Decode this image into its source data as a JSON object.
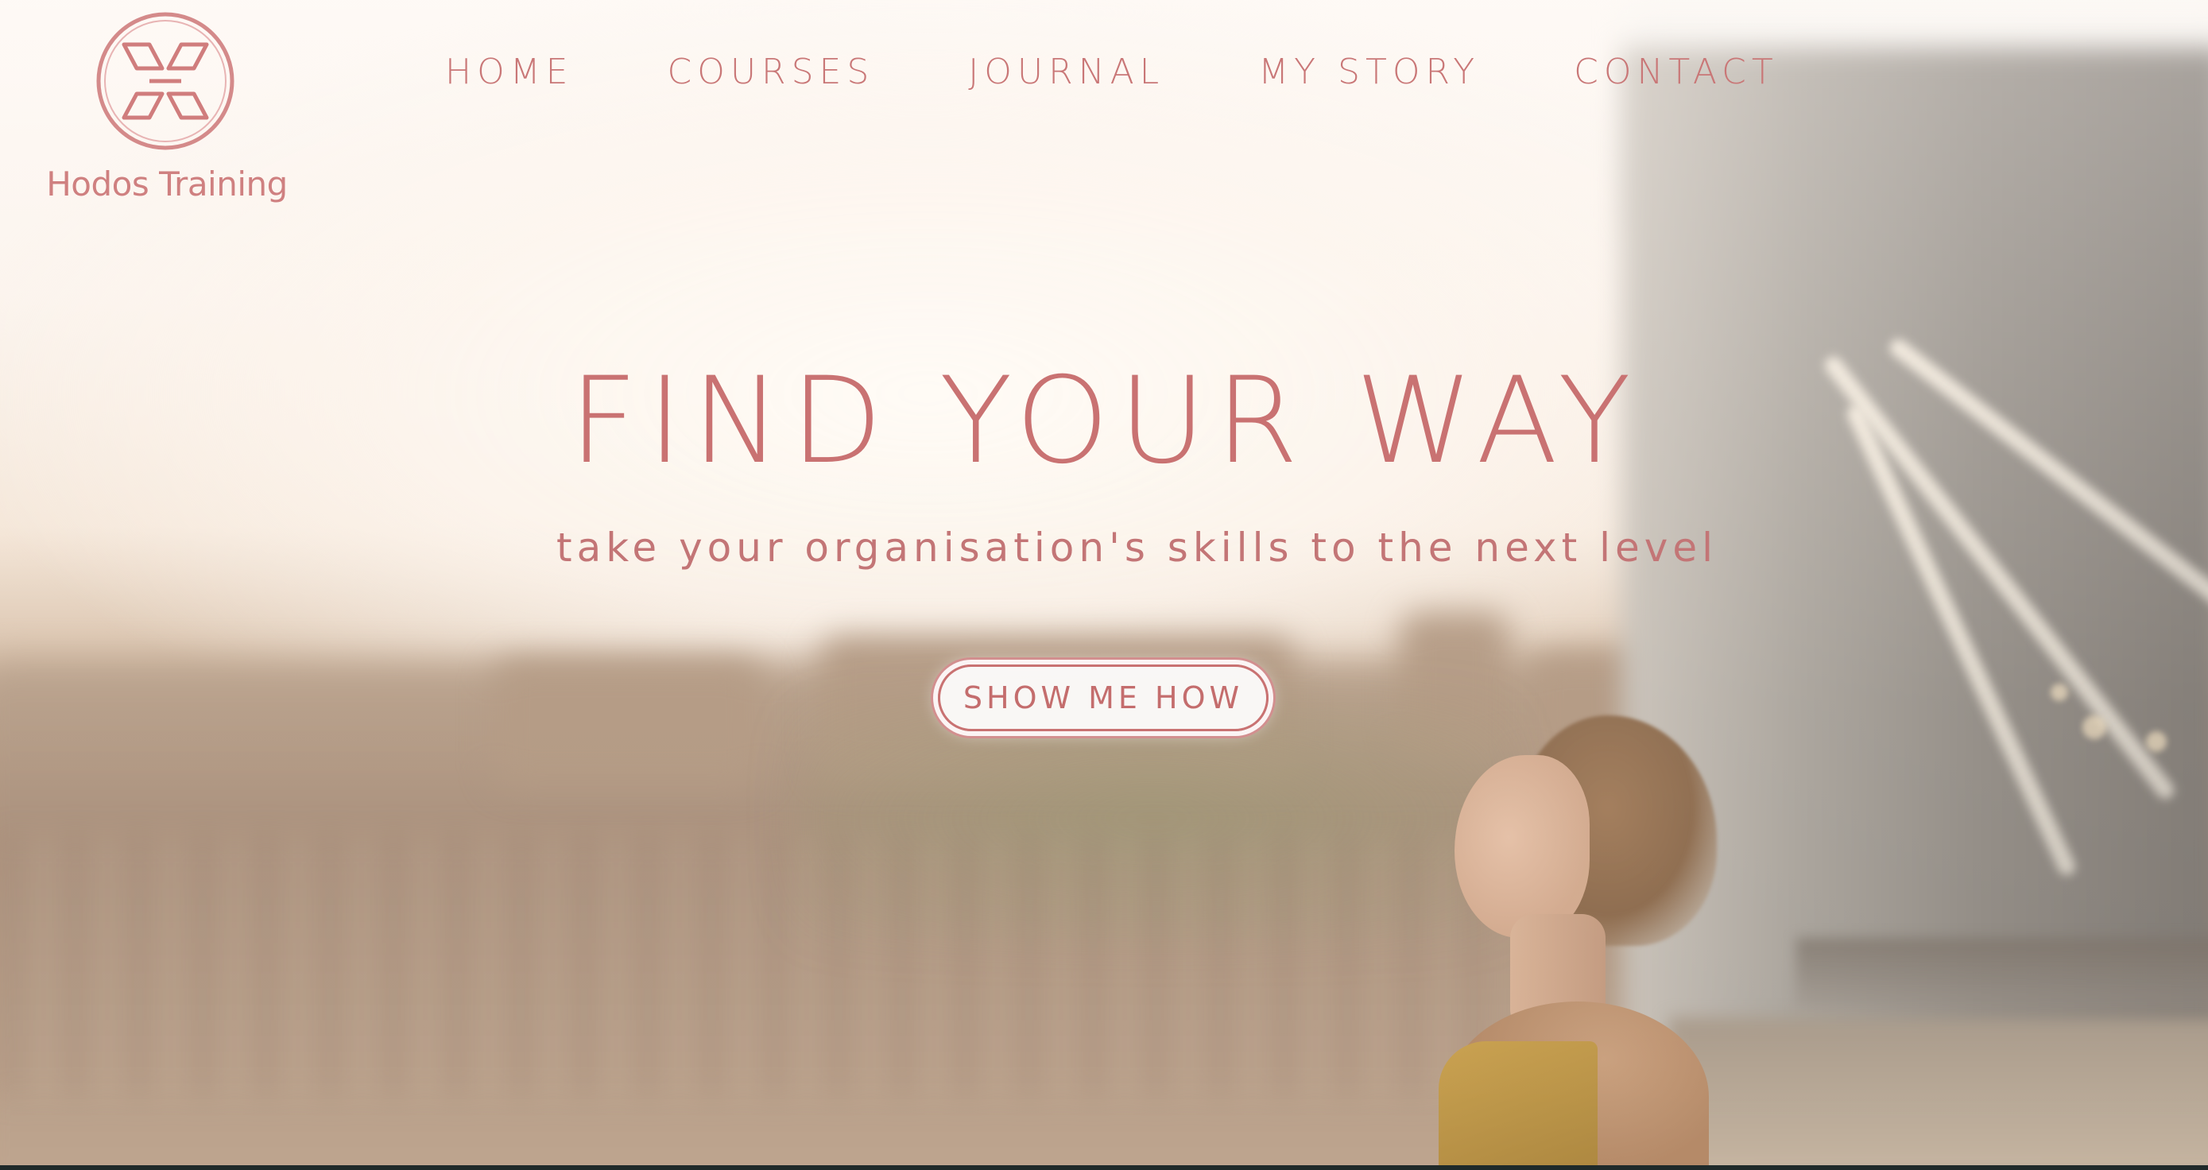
{
  "brand": {
    "name": "Hodos Training",
    "logo_icon": "hodos-logo-icon",
    "accent_color": "#c97272"
  },
  "nav": {
    "items": [
      {
        "label": "HOME"
      },
      {
        "label": "COURSES"
      },
      {
        "label": "JOURNAL"
      },
      {
        "label": "MY STORY"
      },
      {
        "label": "CONTACT"
      }
    ]
  },
  "hero": {
    "title": "FIND YOUR WAY",
    "subtitle": "take your organisation's skills to the next level",
    "cta_label": "SHOW ME HOW"
  }
}
